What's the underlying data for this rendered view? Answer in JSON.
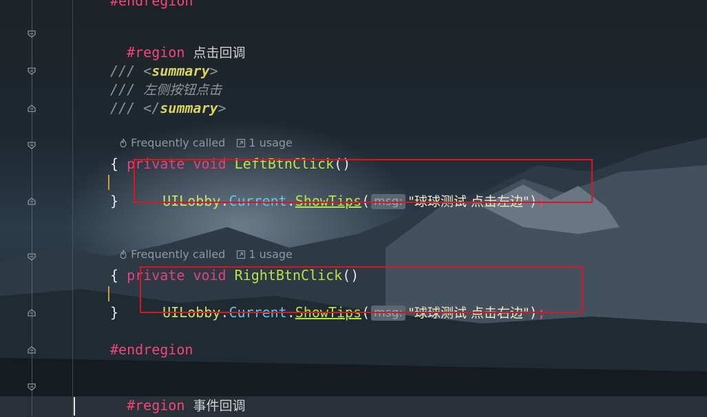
{
  "editor": {
    "code": {
      "partial_top": "#endregion",
      "region_click": {
        "keyword": "#region",
        "title": "点击回调"
      },
      "doc_comment": {
        "slashes": "///",
        "open_tag": "summary",
        "text": "左侧按钮点击",
        "close_tag": "summary"
      },
      "codelens_1": {
        "frequency": "Frequently called",
        "usage": "1 usage"
      },
      "method_1": {
        "modifier": "private",
        "return_type": "void",
        "name": "LeftBtnClick",
        "parens": "()"
      },
      "brace_open": "{",
      "brace_close": "}",
      "call_1": {
        "class": "UILobby",
        "prop": "Current",
        "method": "ShowTips",
        "param_hint": "msg:",
        "arg": "\"球球测试 点击左边\""
      },
      "codelens_2": {
        "frequency": "Frequently called",
        "usage": "1 usage"
      },
      "method_2": {
        "modifier": "private",
        "return_type": "void",
        "name": "RightBtnClick",
        "parens": "()"
      },
      "call_2": {
        "class": "UILobby",
        "prop": "Current",
        "method": "ShowTips",
        "param_hint": "msg:",
        "arg": "\"球球测试 点击右边\""
      },
      "endregion": "#endregion",
      "region_event": {
        "keyword": "#region",
        "title": "事件回调"
      }
    },
    "colors": {
      "region_keyword": "#f0477a",
      "method_name": "#b6e34a",
      "property": "#5fc8e8",
      "highlight_box": "#e0141e"
    },
    "icons": {
      "codelens_frequency": "flame-icon",
      "codelens_usage": "link-arrow-icon",
      "fold": "fold-marker-icon"
    }
  }
}
